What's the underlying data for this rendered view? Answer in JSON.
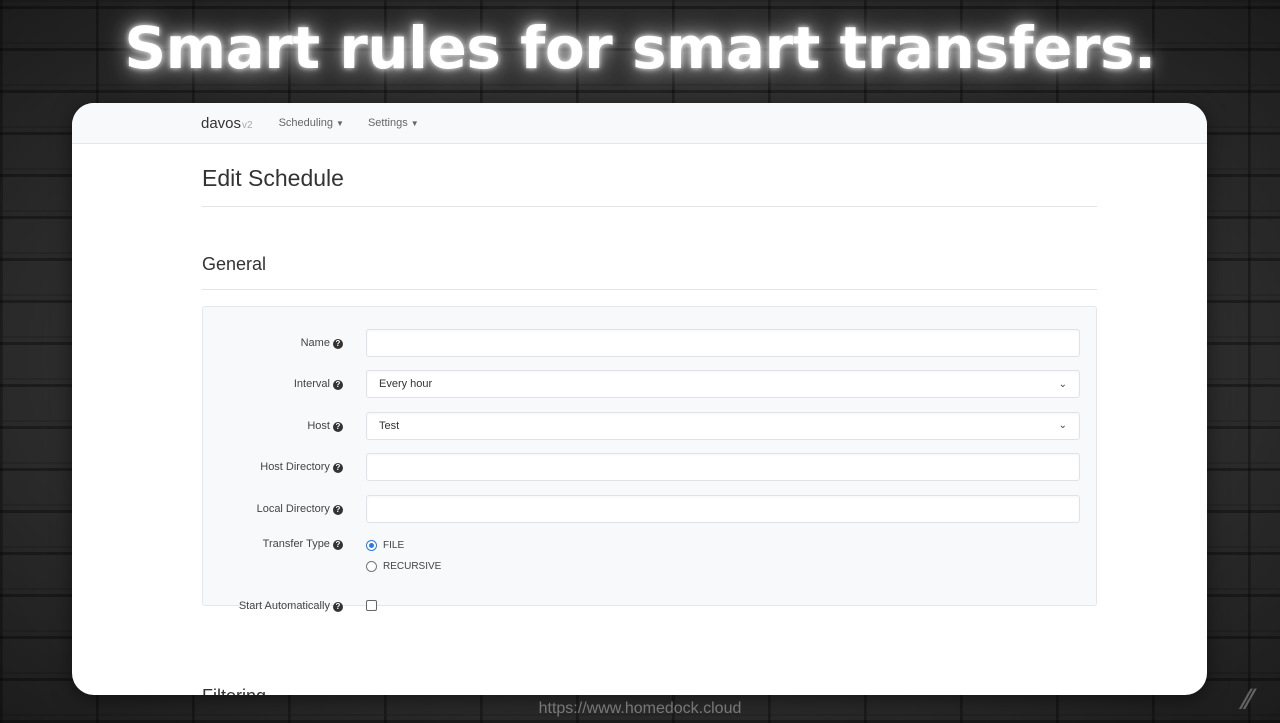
{
  "headline": "Smart rules for smart transfers.",
  "navbar": {
    "brand": "davos",
    "version": "v2",
    "items": [
      {
        "label": "Scheduling"
      },
      {
        "label": "Settings"
      }
    ]
  },
  "page": {
    "title": "Edit Schedule",
    "section_general": "General",
    "section_filtering": "Filtering"
  },
  "form": {
    "name": {
      "label": "Name",
      "value": ""
    },
    "interval": {
      "label": "Interval",
      "value": "Every hour"
    },
    "host": {
      "label": "Host",
      "value": "Test"
    },
    "host_directory": {
      "label": "Host Directory",
      "value": ""
    },
    "local_directory": {
      "label": "Local Directory",
      "value": ""
    },
    "transfer_type": {
      "label": "Transfer Type",
      "options": [
        {
          "label": "FILE",
          "selected": true
        },
        {
          "label": "RECURSIVE",
          "selected": false
        }
      ]
    },
    "start_automatically": {
      "label": "Start Automatically",
      "checked": false
    }
  },
  "footer": {
    "url": "https://www.homedock.cloud"
  },
  "colors": {
    "accent": "#2a7be4",
    "navbar_bg": "#f8f9fb",
    "panel_bg": "#f7f9fb"
  }
}
